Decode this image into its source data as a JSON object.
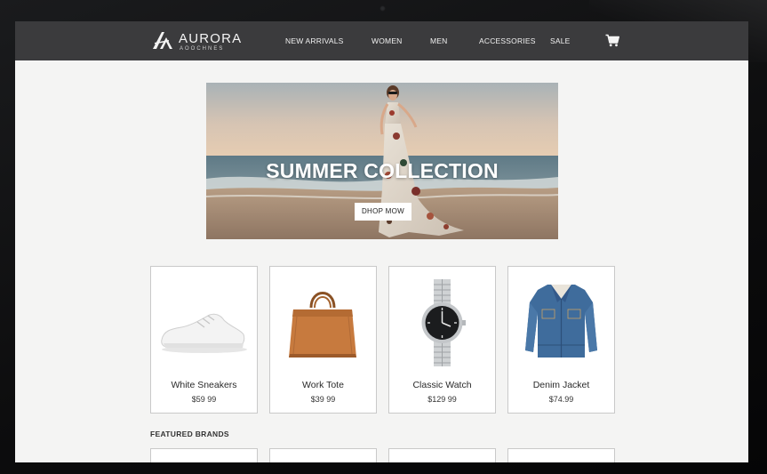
{
  "brand": {
    "name": "AURORA",
    "tagline": "AOOCHNES"
  },
  "nav": {
    "items": [
      {
        "label": "NEW ARRIVALS"
      },
      {
        "label": "WOMEN"
      },
      {
        "label": "MEN"
      },
      {
        "label": "ACCESSORIES"
      },
      {
        "label": "SALE"
      }
    ],
    "cart_icon": "shopping-cart-icon"
  },
  "hero": {
    "title": "SUMMER COLLECTION",
    "button_label": "DHOP MOW"
  },
  "products": [
    {
      "name": "White Sneakers",
      "price": "$59 99",
      "image": "white-sneakers-image"
    },
    {
      "name": "Work Tote",
      "price": "$39 99",
      "image": "work-tote-image"
    },
    {
      "name": "Classic Watch",
      "price": "$129 99",
      "image": "classic-watch-image"
    },
    {
      "name": "Denim Jacket",
      "price": "$74.99",
      "image": "denim-jacket-image"
    }
  ],
  "featured_brands": {
    "heading": "FEATURED BRANDS"
  },
  "colors": {
    "navbar": "#3b3b3d",
    "page_background": "#f4f4f3",
    "card_border": "#c9c9c9",
    "hero_button": "#ffffff"
  }
}
